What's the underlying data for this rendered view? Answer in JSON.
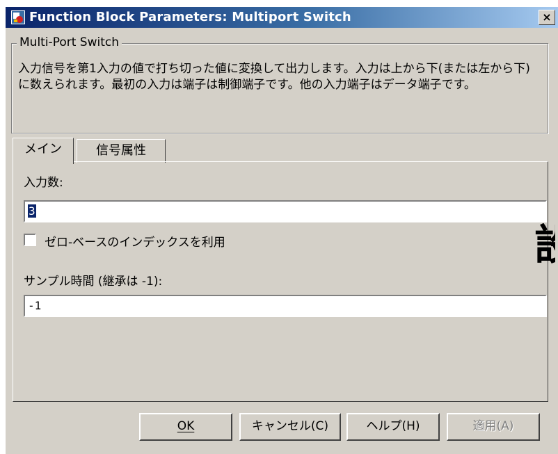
{
  "window": {
    "title": "Function Block Parameters: Multiport Switch",
    "close_label": "×"
  },
  "description": {
    "group_title": "Multi-Port Switch",
    "text": "入力信号を第1入力の値で打ち切った値に変換して出力します。入力は上から下(または左から下)に数えられます。最初の入力は端子は制御端子です。他の入力端子はデータ端子です。"
  },
  "tabs": [
    {
      "label": "メイン",
      "active": true
    },
    {
      "label": "信号属性",
      "active": false
    }
  ],
  "main": {
    "num_inputs_label": "入力数:",
    "num_inputs_value": "3",
    "zero_based_label": "ゼロ-ベースのインデックスを利用",
    "zero_based_checked": false,
    "sample_time_label": "サンプル時間 (継承は -1):",
    "sample_time_value": "-1",
    "overflow_glyph": "設"
  },
  "buttons": {
    "ok": "OK",
    "cancel": "キャンセル(C)",
    "help": "ヘルプ(H)",
    "apply": "適用(A)"
  },
  "colors": {
    "dialog_bg": "#d4d0c8",
    "titlebar_start": "#0a246a",
    "titlebar_end": "#a6caf0",
    "selection": "#0a246a"
  },
  "icons": {
    "app": "simulink-block-icon",
    "close": "close-icon"
  }
}
